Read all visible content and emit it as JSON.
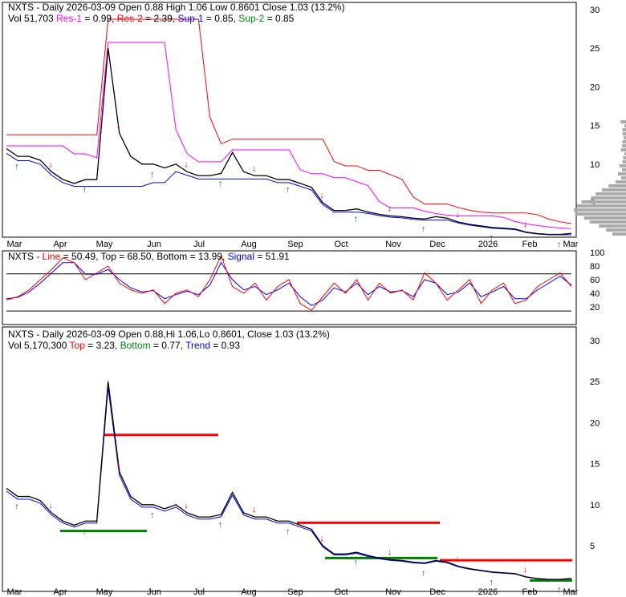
{
  "panel1": {
    "title": "NXTS - Daily 2026-03-09 Open 0.88  High 1.06  Low 0.8601  Close 1.03 (13.2%)",
    "vol": "Vol 51,703",
    "res1_label": "Res-1",
    "res1_val": " = 0.99,",
    "res2_label": "Res-2",
    "res2_val": " = 2.39,",
    "sup1_label": "Sup-1",
    "sup1_val": " = 0.85,",
    "sup2_label": "Sup-2",
    "sup2_val": " = 0.85"
  },
  "panel2": {
    "prefix": "NXTS - ",
    "line_label": "Line",
    "line_val": " = 50.49, Top = 68.50, Bottom = 13.99, ",
    "signal_label": "Signal",
    "signal_val": " = 51.91"
  },
  "panel3": {
    "title": "NXTS - Daily 2026-03-09 Open 0.88,Hi 1.06,Lo 0.8601, Close 1.03 (13.2%)",
    "vol": "Vol 5,170,300 ",
    "top_label": "Top",
    "top_val": " = 3.23, ",
    "bottom_label": "Bottom",
    "bottom_val": " = 0.77, ",
    "trend_label": "Trend",
    "trend_val": " = 0.93"
  },
  "colors": {
    "res1": "#ff00ff",
    "res2": "#ff0000",
    "sup1": "#0000ff",
    "sup2": "#008000",
    "up": "#008000",
    "down": "#ff0000"
  },
  "chart_data": {
    "type": "line",
    "x_labels": [
      "Mar",
      "Apr",
      "May",
      "Jun",
      "Jul",
      "Aug",
      "Sep",
      "Oct",
      "Nov",
      "Dec",
      "2026",
      "Feb",
      "Mar"
    ],
    "price_ticks": [
      30,
      25,
      20,
      15,
      10,
      5
    ],
    "osc_ticks": [
      100,
      80,
      60,
      40,
      20
    ],
    "weekly_close": [
      12,
      11,
      11,
      10.5,
      9,
      8,
      7.5,
      8,
      8,
      25,
      14,
      11,
      10,
      10,
      9.5,
      10,
      9,
      8.5,
      8.5,
      8.8,
      11.5,
      9,
      8.5,
      8.5,
      8,
      8,
      7.5,
      7,
      5,
      4,
      4,
      4.2,
      3.8,
      3.5,
      3.3,
      3.2,
      3,
      2.9,
      3.2,
      3,
      2.5,
      2.2,
      2,
      1.8,
      1.7,
      1.6,
      1.2,
      1.0,
      0.9,
      0.9,
      1.03
    ],
    "stoch_line": [
      30,
      35,
      45,
      60,
      75,
      92,
      85,
      60,
      70,
      80,
      55,
      45,
      40,
      45,
      25,
      40,
      45,
      35,
      60,
      95,
      50,
      40,
      55,
      30,
      50,
      60,
      25,
      15,
      35,
      55,
      40,
      60,
      30,
      55,
      40,
      45,
      30,
      70,
      55,
      30,
      45,
      60,
      25,
      45,
      55,
      25,
      30,
      50,
      60,
      70,
      50
    ],
    "stoch_signal": [
      32,
      34,
      42,
      55,
      70,
      85,
      85,
      68,
      68,
      75,
      60,
      48,
      42,
      44,
      32,
      38,
      43,
      38,
      52,
      85,
      60,
      45,
      50,
      38,
      45,
      55,
      35,
      22,
      30,
      48,
      42,
      55,
      38,
      50,
      42,
      44,
      35,
      60,
      55,
      38,
      42,
      55,
      35,
      42,
      50,
      32,
      32,
      45,
      55,
      65,
      52
    ],
    "osc_top": 68.5,
    "osc_bottom": 13.99,
    "trend_top": 3.23,
    "trend_bottom": 0.77,
    "trend": 0.93
  }
}
